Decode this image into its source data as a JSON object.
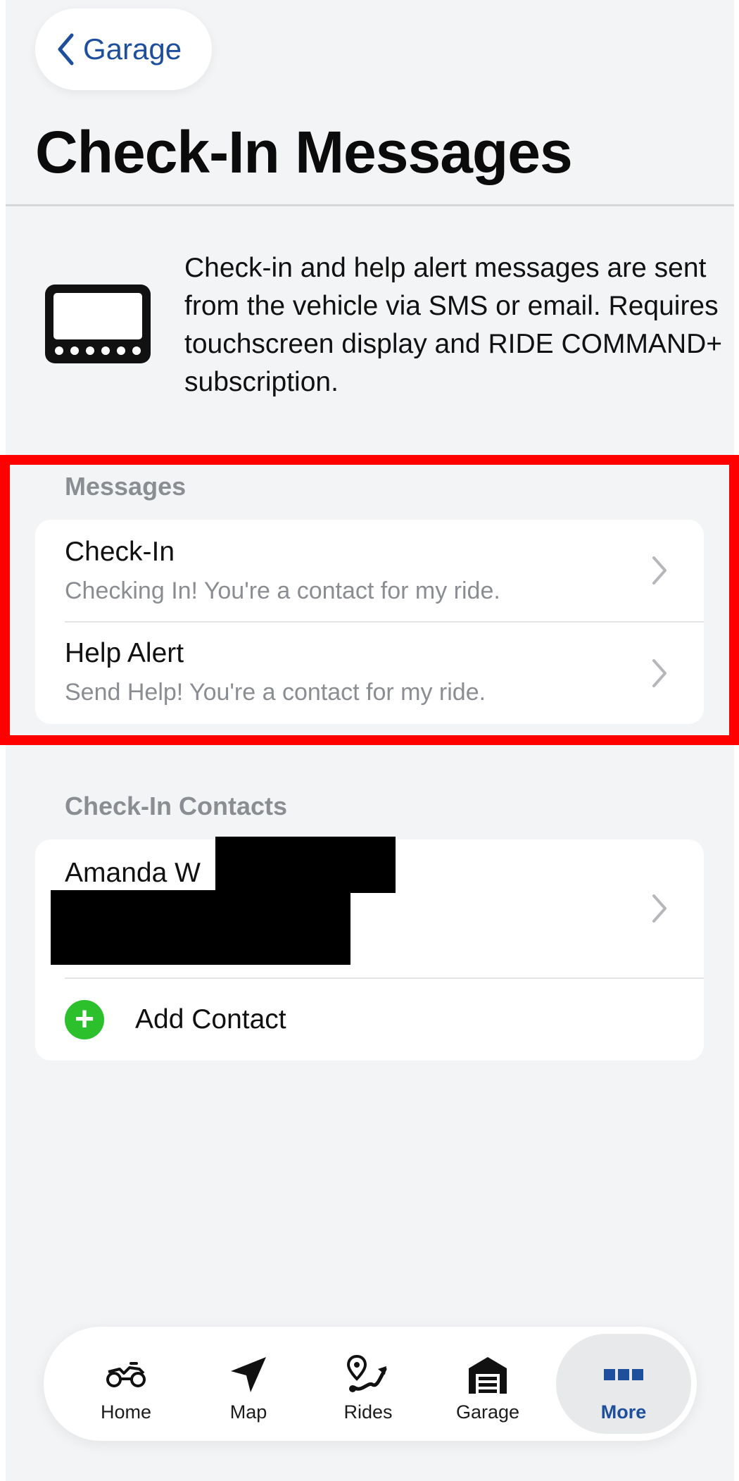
{
  "nav": {
    "back_label": "Garage"
  },
  "page": {
    "title": "Check-In Messages"
  },
  "intro": {
    "text": "Check-in and help alert messages are sent from the vehicle via SMS or email. Requires touchscreen display and RIDE COMMAND+ subscription.",
    "icon": "touchscreen-display-icon"
  },
  "messages": {
    "header": "Messages",
    "items": [
      {
        "title": "Check-In",
        "subtitle": "Checking In! You're a contact for my ride."
      },
      {
        "title": "Help Alert",
        "subtitle": "Send Help! You're a contact for my ride."
      }
    ]
  },
  "contacts": {
    "header": "Check-In Contacts",
    "items": [
      {
        "name": "Amanda W"
      }
    ],
    "add_label": "Add Contact"
  },
  "tabbar": {
    "items": [
      {
        "label": "Home",
        "icon": "atv-icon"
      },
      {
        "label": "Map",
        "icon": "navigation-arrow-icon"
      },
      {
        "label": "Rides",
        "icon": "route-icon"
      },
      {
        "label": "Garage",
        "icon": "garage-icon"
      },
      {
        "label": "More",
        "icon": "more-dots-icon"
      }
    ],
    "active": "More"
  },
  "colors": {
    "accent": "#1d4f9c",
    "background": "#f3f4f5",
    "highlight": "#ff0000",
    "add_green": "#2cc12c",
    "secondary_text": "#8a8d91"
  }
}
